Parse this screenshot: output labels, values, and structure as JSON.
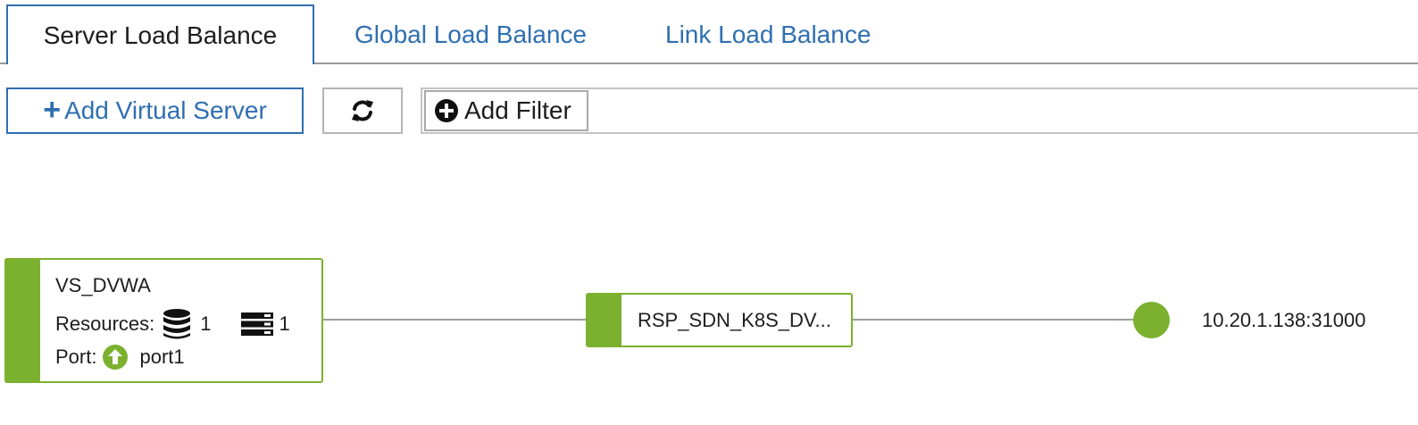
{
  "tabs": [
    {
      "label": "Server Load Balance",
      "active": true
    },
    {
      "label": "Global Load Balance",
      "active": false
    },
    {
      "label": "Link Load Balance",
      "active": false
    }
  ],
  "toolbar": {
    "add_label": "Add Virtual Server",
    "add_icon": "plus-icon",
    "refresh_icon": "refresh-icon",
    "filter_label": "Add Filter",
    "filter_icon": "plus-circle-icon"
  },
  "topology": {
    "virtual_server": {
      "name": "VS_DVWA",
      "resources_label": "Resources:",
      "database_icon": "database-icon",
      "database_count": "1",
      "server_icon": "server-icon",
      "server_count": "1",
      "port_label": "Port:",
      "port_icon": "arrow-up-circle-icon",
      "port_name": "port1"
    },
    "pool": {
      "name": "RSP_SDN_K8S_DV..."
    },
    "real_server": {
      "address": "10.20.1.138:31000",
      "status_color": "#7bb12e"
    }
  },
  "colors": {
    "accent": "#2f6fb0",
    "status_green": "#7bb12e"
  }
}
